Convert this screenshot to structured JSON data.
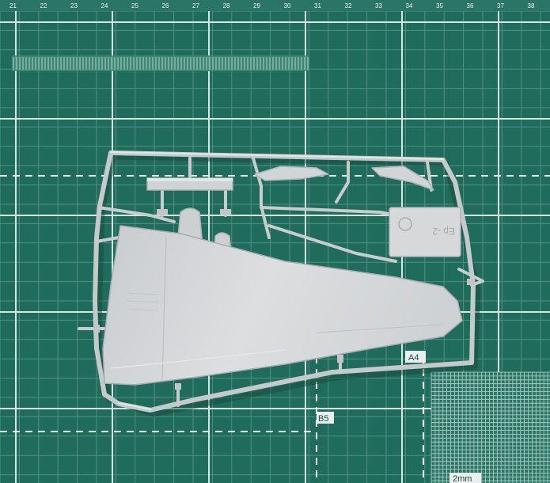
{
  "colors": {
    "mat": "#1f6b5c",
    "grid_minor": "#4d8f80",
    "grid_major": "#cfe3dc",
    "plastic": "#d3d6d8",
    "plastic_shade": "#b9bcbf",
    "plastic_light": "#e3e5e7"
  },
  "mat": {
    "ruler_numbers": [
      "21",
      "22",
      "23",
      "24",
      "25",
      "26",
      "27",
      "28",
      "29",
      "30",
      "31",
      "32",
      "33",
      "34",
      "35",
      "36",
      "37",
      "38"
    ],
    "labels": {
      "a4": "A4",
      "b5": "B5",
      "scale": "2mm"
    }
  },
  "sprue": {
    "part_marking": "Ep -2"
  }
}
